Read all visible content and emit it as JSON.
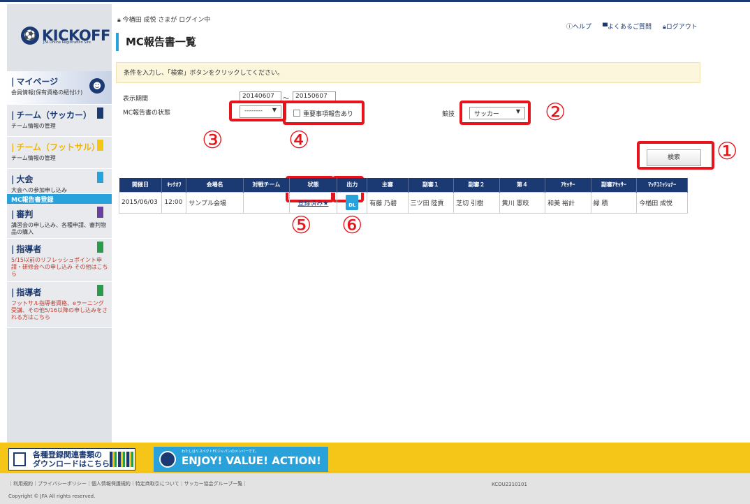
{
  "header": {
    "login_status": "今楢田 成悦 さまが ログイン中",
    "help": "ヘルプ",
    "faq": "よくあるご質問",
    "logout": "ログアウト"
  },
  "logo": {
    "text": "KICKOFF",
    "sub": "JFA Online Registration Site"
  },
  "sidebar": {
    "items": [
      {
        "title": "マイページ",
        "desc": "会員情報(保有資格の紐付け)"
      },
      {
        "title": "チーム（サッカー）",
        "desc": "チーム情報の管理",
        "flag": "#1b3a73"
      },
      {
        "title": "チーム（フットサル）",
        "desc": "チーム情報の管理",
        "flag": "#f5c517"
      },
      {
        "title": "大会",
        "desc": "大会への参加申し込み",
        "flag": "#29a2dc",
        "active_sub": "MC報告書登録"
      },
      {
        "title": "審判",
        "desc": "講習会の申し込み、各種申請、審判物品の購入",
        "flag": "#6b3fa0"
      },
      {
        "title": "指導者",
        "desc": "5/15以前のリフレッシュポイント申請・研修会への申し込み その他はこちら",
        "flag": "#2b9a4d"
      },
      {
        "title": "指導者",
        "desc": "フットサル指導者資格、eラーニング受講、その他5/16以降の申し込みをされる方はこちら",
        "flag": "#2b9a4d"
      }
    ]
  },
  "page_title": "MC報告書一覧",
  "notice": "条件を入力し、「検索」ボタンをクリックしてください。",
  "form": {
    "period_label": "表示期間",
    "date_from": "20140607",
    "date_sep": "～",
    "date_to": "20150607",
    "status_label": "MC報告書の状態",
    "status_value": "--------",
    "important_label": "重要事項報告あり",
    "sport_label": "競技",
    "sport_value": "サッカー",
    "search_button": "検索"
  },
  "annotations": [
    "①",
    "②",
    "③",
    "④",
    "⑤",
    "⑥"
  ],
  "table": {
    "headers": [
      "開催日",
      "ｷｯｸｵﾌ",
      "会場名",
      "対戦チーム",
      "状態",
      "出力",
      "主審",
      "副審１",
      "副審２",
      "第４",
      "ｱｾｯｻｰ",
      "副審ｱｾｯｻｰ",
      "ﾏｯﾁｺﾐｯｼｮﾅｰ"
    ],
    "row": {
      "date": "2015/06/03",
      "kickoff": "12:00",
      "venue": "サンプル会場",
      "opponent": "",
      "status": "登録済み★",
      "output": "DL",
      "referee": "有藤 乃碧",
      "ar1": "三ツ田 陸貢",
      "ar2": "芝切 引樹",
      "fourth": "黄川 憲皎",
      "assessor": "和美 裕計",
      "ar_assessor": "緑 積",
      "commissioner": "今楢田 成悦"
    }
  },
  "footer": {
    "download_line1": "各種登録関連書類の",
    "download_line2": "ダウンロードはこちら",
    "enjoy": "ENJOY! VALUE! ACTION!",
    "enjoy_small": "わたしはリスペクトFCジャパンのメンバーです。",
    "links": "｜利用規約｜プライバシーポリシー｜個人情報保護規約｜特定商取引について｜サッカー協会グループ一覧｜",
    "copyright": "Copyright © JFA All rights reserved.",
    "page_code": "KCOU2310101"
  }
}
